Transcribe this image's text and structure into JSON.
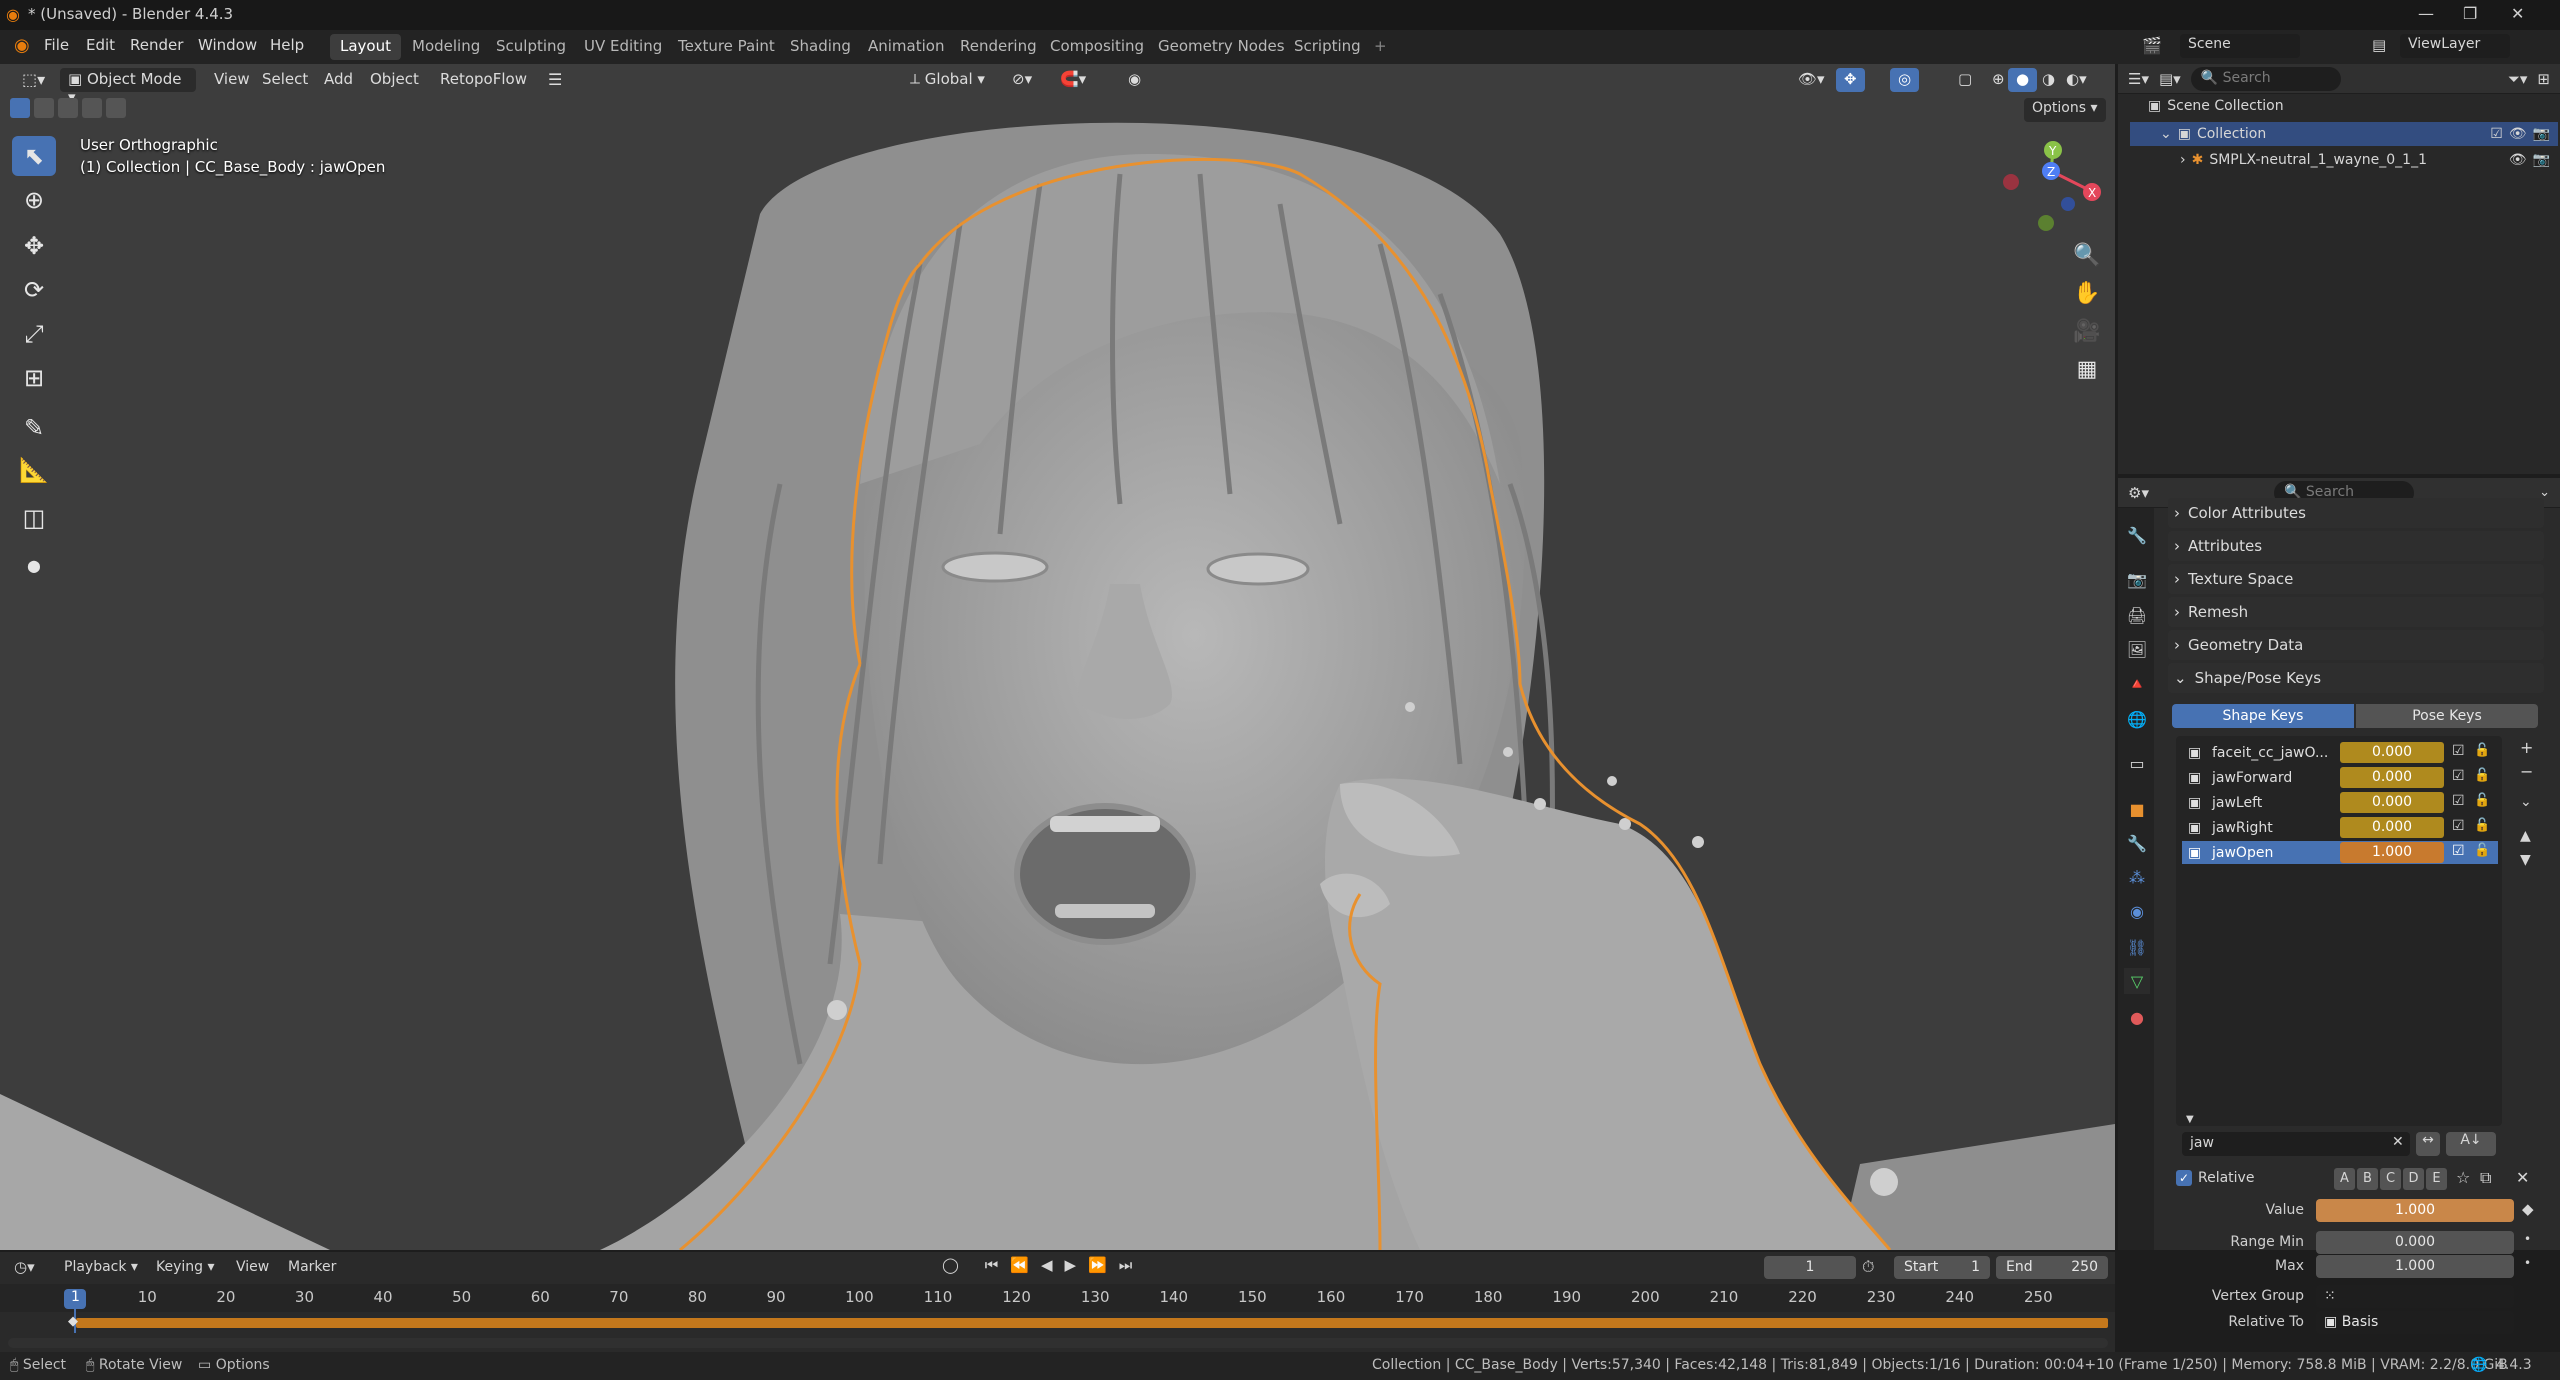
{
  "window": {
    "title": "* (Unsaved) - Blender 4.4.3",
    "minimize": "—",
    "maximize": "❐",
    "close": "✕"
  },
  "menus": [
    "File",
    "Edit",
    "Render",
    "Window",
    "Help"
  ],
  "workspaces": [
    "Layout",
    "Modeling",
    "Sculpting",
    "UV Editing",
    "Texture Paint",
    "Shading",
    "Animation",
    "Rendering",
    "Compositing",
    "Geometry Nodes",
    "Scripting",
    "+"
  ],
  "scene": {
    "label": "Scene",
    "view_layer": "ViewLayer"
  },
  "viewport_header": {
    "mode": "Object Mode",
    "menus": [
      "View",
      "Select",
      "Add",
      "Object"
    ],
    "addon": "RetopoFlow",
    "orientation": "Global",
    "options": "Options"
  },
  "overlay_text": {
    "view": "User Orthographic",
    "context": "(1) Collection | CC_Base_Body : jawOpen"
  },
  "gizmo": {
    "x": "X",
    "y": "Y",
    "z": "Z"
  },
  "outliner": {
    "search_placeholder": "Search",
    "root": "Scene Collection",
    "collection": "Collection",
    "object": "SMPLX-neutral_1_wayne_0_1_1"
  },
  "properties": {
    "search_placeholder": "Search",
    "sections": [
      "Color Attributes",
      "Attributes",
      "Texture Space",
      "Remesh",
      "Geometry Data",
      "Shape/Pose Keys"
    ],
    "tabs": {
      "shape": "Shape Keys",
      "pose": "Pose Keys"
    },
    "shape_keys": [
      {
        "name": "faceit_cc_jawO...",
        "value": "0.000",
        "selected": false
      },
      {
        "name": "jawForward",
        "value": "0.000",
        "selected": false
      },
      {
        "name": "jawLeft",
        "value": "0.000",
        "selected": false
      },
      {
        "name": "jawRight",
        "value": "0.000",
        "selected": false
      },
      {
        "name": "jawOpen",
        "value": "1.000",
        "selected": true
      }
    ],
    "filter_text": "jaw",
    "relative_label": "Relative",
    "sort_letters": [
      "A",
      "B",
      "C",
      "D",
      "E"
    ],
    "value": {
      "label": "Value",
      "value": "1.000",
      "fill": 1.0
    },
    "range_min": {
      "label": "Range Min",
      "value": "0.000"
    },
    "max": {
      "label": "Max",
      "value": "1.000"
    },
    "vertex_group": {
      "label": "Vertex Group",
      "value": ""
    },
    "relative_to": {
      "label": "Relative To",
      "value": "Basis"
    }
  },
  "timeline": {
    "menus": [
      "Playback",
      "Keying",
      "View",
      "Marker"
    ],
    "current_frame": "1",
    "start_label": "Start",
    "start": "1",
    "end_label": "End",
    "end": "250",
    "ticks": [
      "1",
      "10",
      "20",
      "30",
      "40",
      "50",
      "60",
      "70",
      "80",
      "90",
      "100",
      "110",
      "120",
      "130",
      "140",
      "150",
      "160",
      "170",
      "180",
      "190",
      "200",
      "210",
      "220",
      "230",
      "240",
      "250"
    ]
  },
  "statusbar": {
    "left": [
      "Select",
      "Rotate View",
      "Options"
    ],
    "right": "Collection | CC_Base_Body | Verts:57,340 | Faces:42,148 | Tris:81,849 | Objects:1/16 | Duration: 00:04+10 (Frame 1/250) | Memory: 758.8 MiB | VRAM: 2.2/8.0 GiB",
    "version": "4.4.3"
  },
  "colors": {
    "accent": "#4772b3",
    "keyed": "#af8a1e",
    "orange_outline": "#e8912f",
    "value_fill": "#c98749"
  }
}
